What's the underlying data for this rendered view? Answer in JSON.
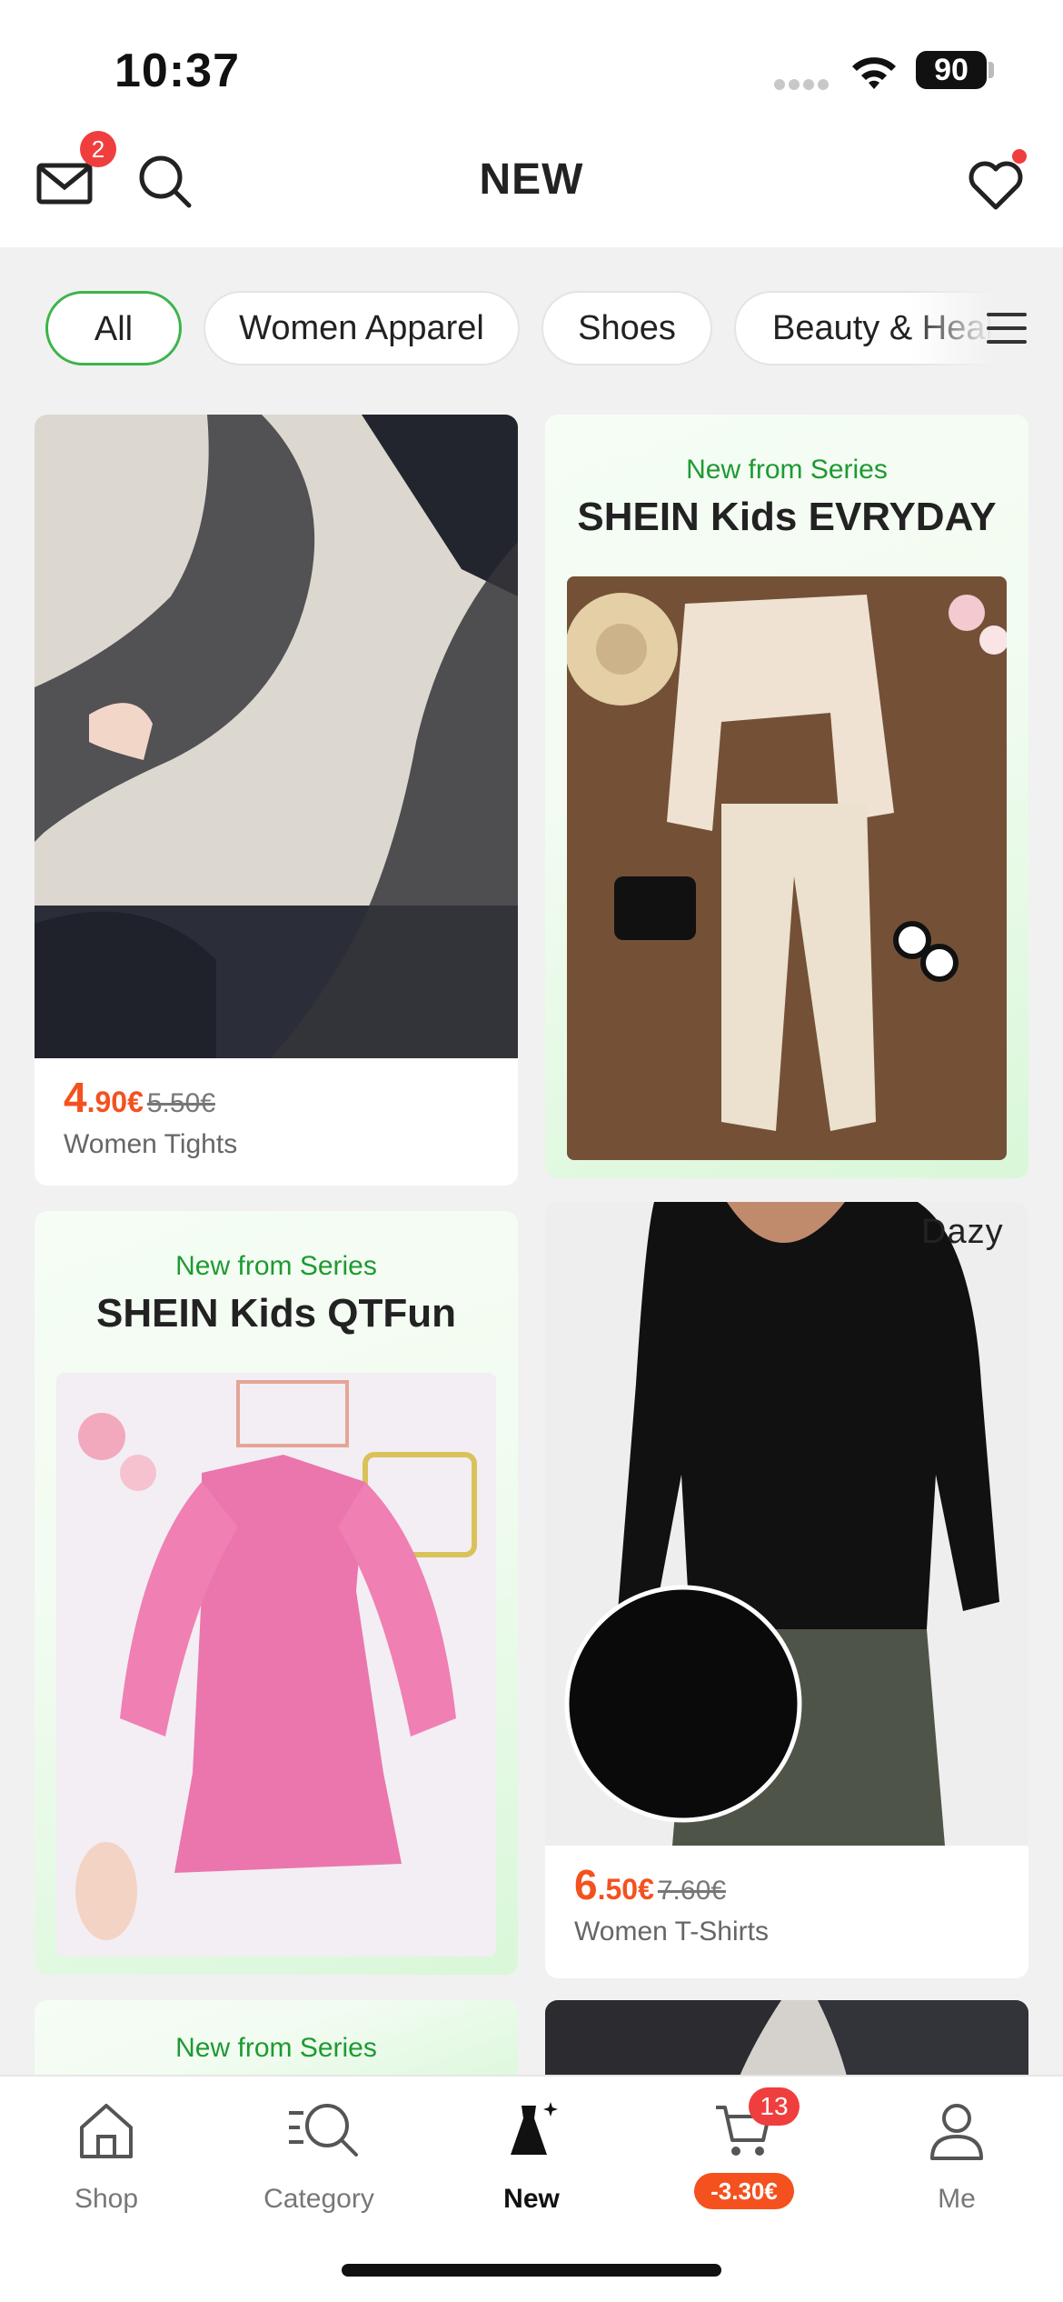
{
  "status_bar": {
    "time": "10:37",
    "battery": "90"
  },
  "header": {
    "title": "NEW",
    "mail_badge": "2"
  },
  "filters": {
    "items": [
      "All",
      "Women Apparel",
      "Shoes",
      "Beauty & Health"
    ],
    "selected": "All"
  },
  "products": [
    {
      "price_int": "4",
      "price_dec": ".90€",
      "price_old": "5.50€",
      "name": "Women Tights"
    },
    {
      "brand": "Dazy",
      "price_int": "6",
      "price_dec": ".50€",
      "price_old": "7.60€",
      "name": "Women T-Shirts"
    }
  ],
  "series": [
    {
      "subtitle": "New from Series",
      "title": "SHEIN Kids EVRYDAY"
    },
    {
      "subtitle": "New from Series",
      "title": "SHEIN Kids QTFun"
    },
    {
      "subtitle": "New from Series"
    }
  ],
  "tabbar": {
    "items": [
      "Shop",
      "Category",
      "New",
      "",
      "Me"
    ],
    "active": "New",
    "cart_badge": "13",
    "cart_discount": "-3.30€"
  },
  "colors": {
    "accent_green": "#3cb44b",
    "price_orange": "#f4511e",
    "badge_red": "#f03e3e"
  }
}
